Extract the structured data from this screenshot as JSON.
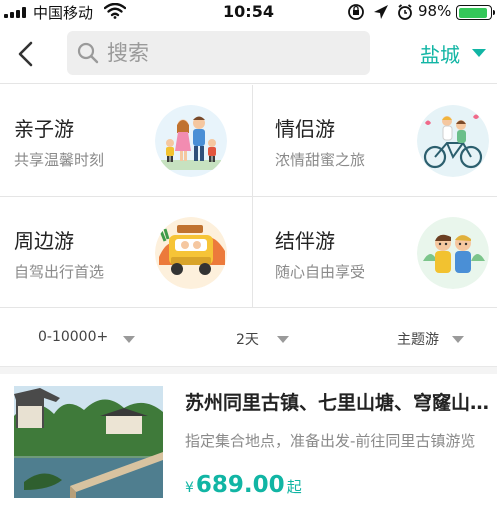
{
  "status_bar": {
    "carrier": "中国移动",
    "time": "10:54",
    "battery_percent": "98%",
    "battery_level": 0.98
  },
  "nav": {
    "search_placeholder": "搜索",
    "city": "盐城"
  },
  "categories": [
    {
      "title": "亲子游",
      "subtitle": "共享温馨时刻",
      "icon": "family-illustration"
    },
    {
      "title": "情侣游",
      "subtitle": "浓情甜蜜之旅",
      "icon": "couple-bicycle-illustration"
    },
    {
      "title": "周边游",
      "subtitle": "自驾出行首选",
      "icon": "car-trip-illustration"
    },
    {
      "title": "结伴游",
      "subtitle": "随心自由享受",
      "icon": "friends-illustration"
    }
  ],
  "filters": {
    "price": "0-10000+",
    "days": "2天",
    "theme": "主题游"
  },
  "product": {
    "title": "苏州同里古镇、七里山塘、穹窿山、平江路纯玩二日游",
    "description": "指定集合地点，准备出发-前往同里古镇游览",
    "currency": "¥",
    "price": "689.00",
    "price_suffix": "起"
  },
  "colors": {
    "accent": "#11b5a4",
    "battery": "#34c759"
  }
}
